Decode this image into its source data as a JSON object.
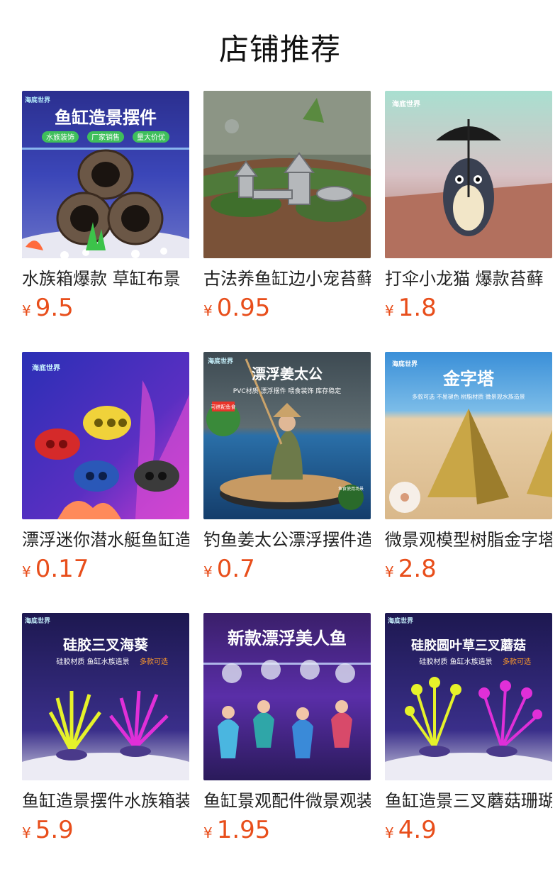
{
  "page": {
    "title": "店铺推荐"
  },
  "currency": "¥",
  "products": [
    {
      "name": "水族箱爆款 草缸布景",
      "price": "9.5",
      "banner": "鱼缸造景摆件",
      "tags": [
        "水族装饰",
        "厂家销售",
        "量大价优"
      ],
      "brand": "海底世界"
    },
    {
      "name": "古法养鱼缸边小宠苔藓",
      "price": "0.95"
    },
    {
      "name": "打伞小龙猫 爆款苔藓",
      "price": "1.8",
      "brand": "海底世界"
    },
    {
      "name": "漂浮迷你潜水艇鱼缸造景",
      "price": "0.17",
      "brand": "海底世界"
    },
    {
      "name": "钓鱼姜太公漂浮摆件造景",
      "price": "0.7",
      "banner": "漂浮姜太公",
      "subtitle": "PVC材质 漂浮摆件 喂食装饰 库存稳定",
      "badge": "可搭配鱼食",
      "badge2": "鱼食使用场景",
      "brand": "海底世界"
    },
    {
      "name": "微景观模型树脂金字塔",
      "price": "2.8",
      "banner": "金字塔",
      "subtitle": "多款可选 不易褪色 树脂材质 微景观水族造景",
      "brand": "海底世界"
    },
    {
      "name": "鱼缸造景摆件水族箱装饰",
      "price": "5.9",
      "banner": "硅胶三叉海葵",
      "subtitle": "硅胶材质 鱼缸水族造景",
      "highlight": "多款可选",
      "brand": "海底世界"
    },
    {
      "name": "鱼缸景观配件微景观装饰",
      "price": "1.95",
      "banner": "新款漂浮美人鱼"
    },
    {
      "name": "鱼缸造景三叉蘑菇珊瑚",
      "price": "4.9",
      "banner": "硅胶圆叶草三叉蘑菇",
      "subtitle": "硅胶材质 鱼缸水族造景",
      "highlight": "多款可选",
      "brand": "海底世界"
    }
  ]
}
